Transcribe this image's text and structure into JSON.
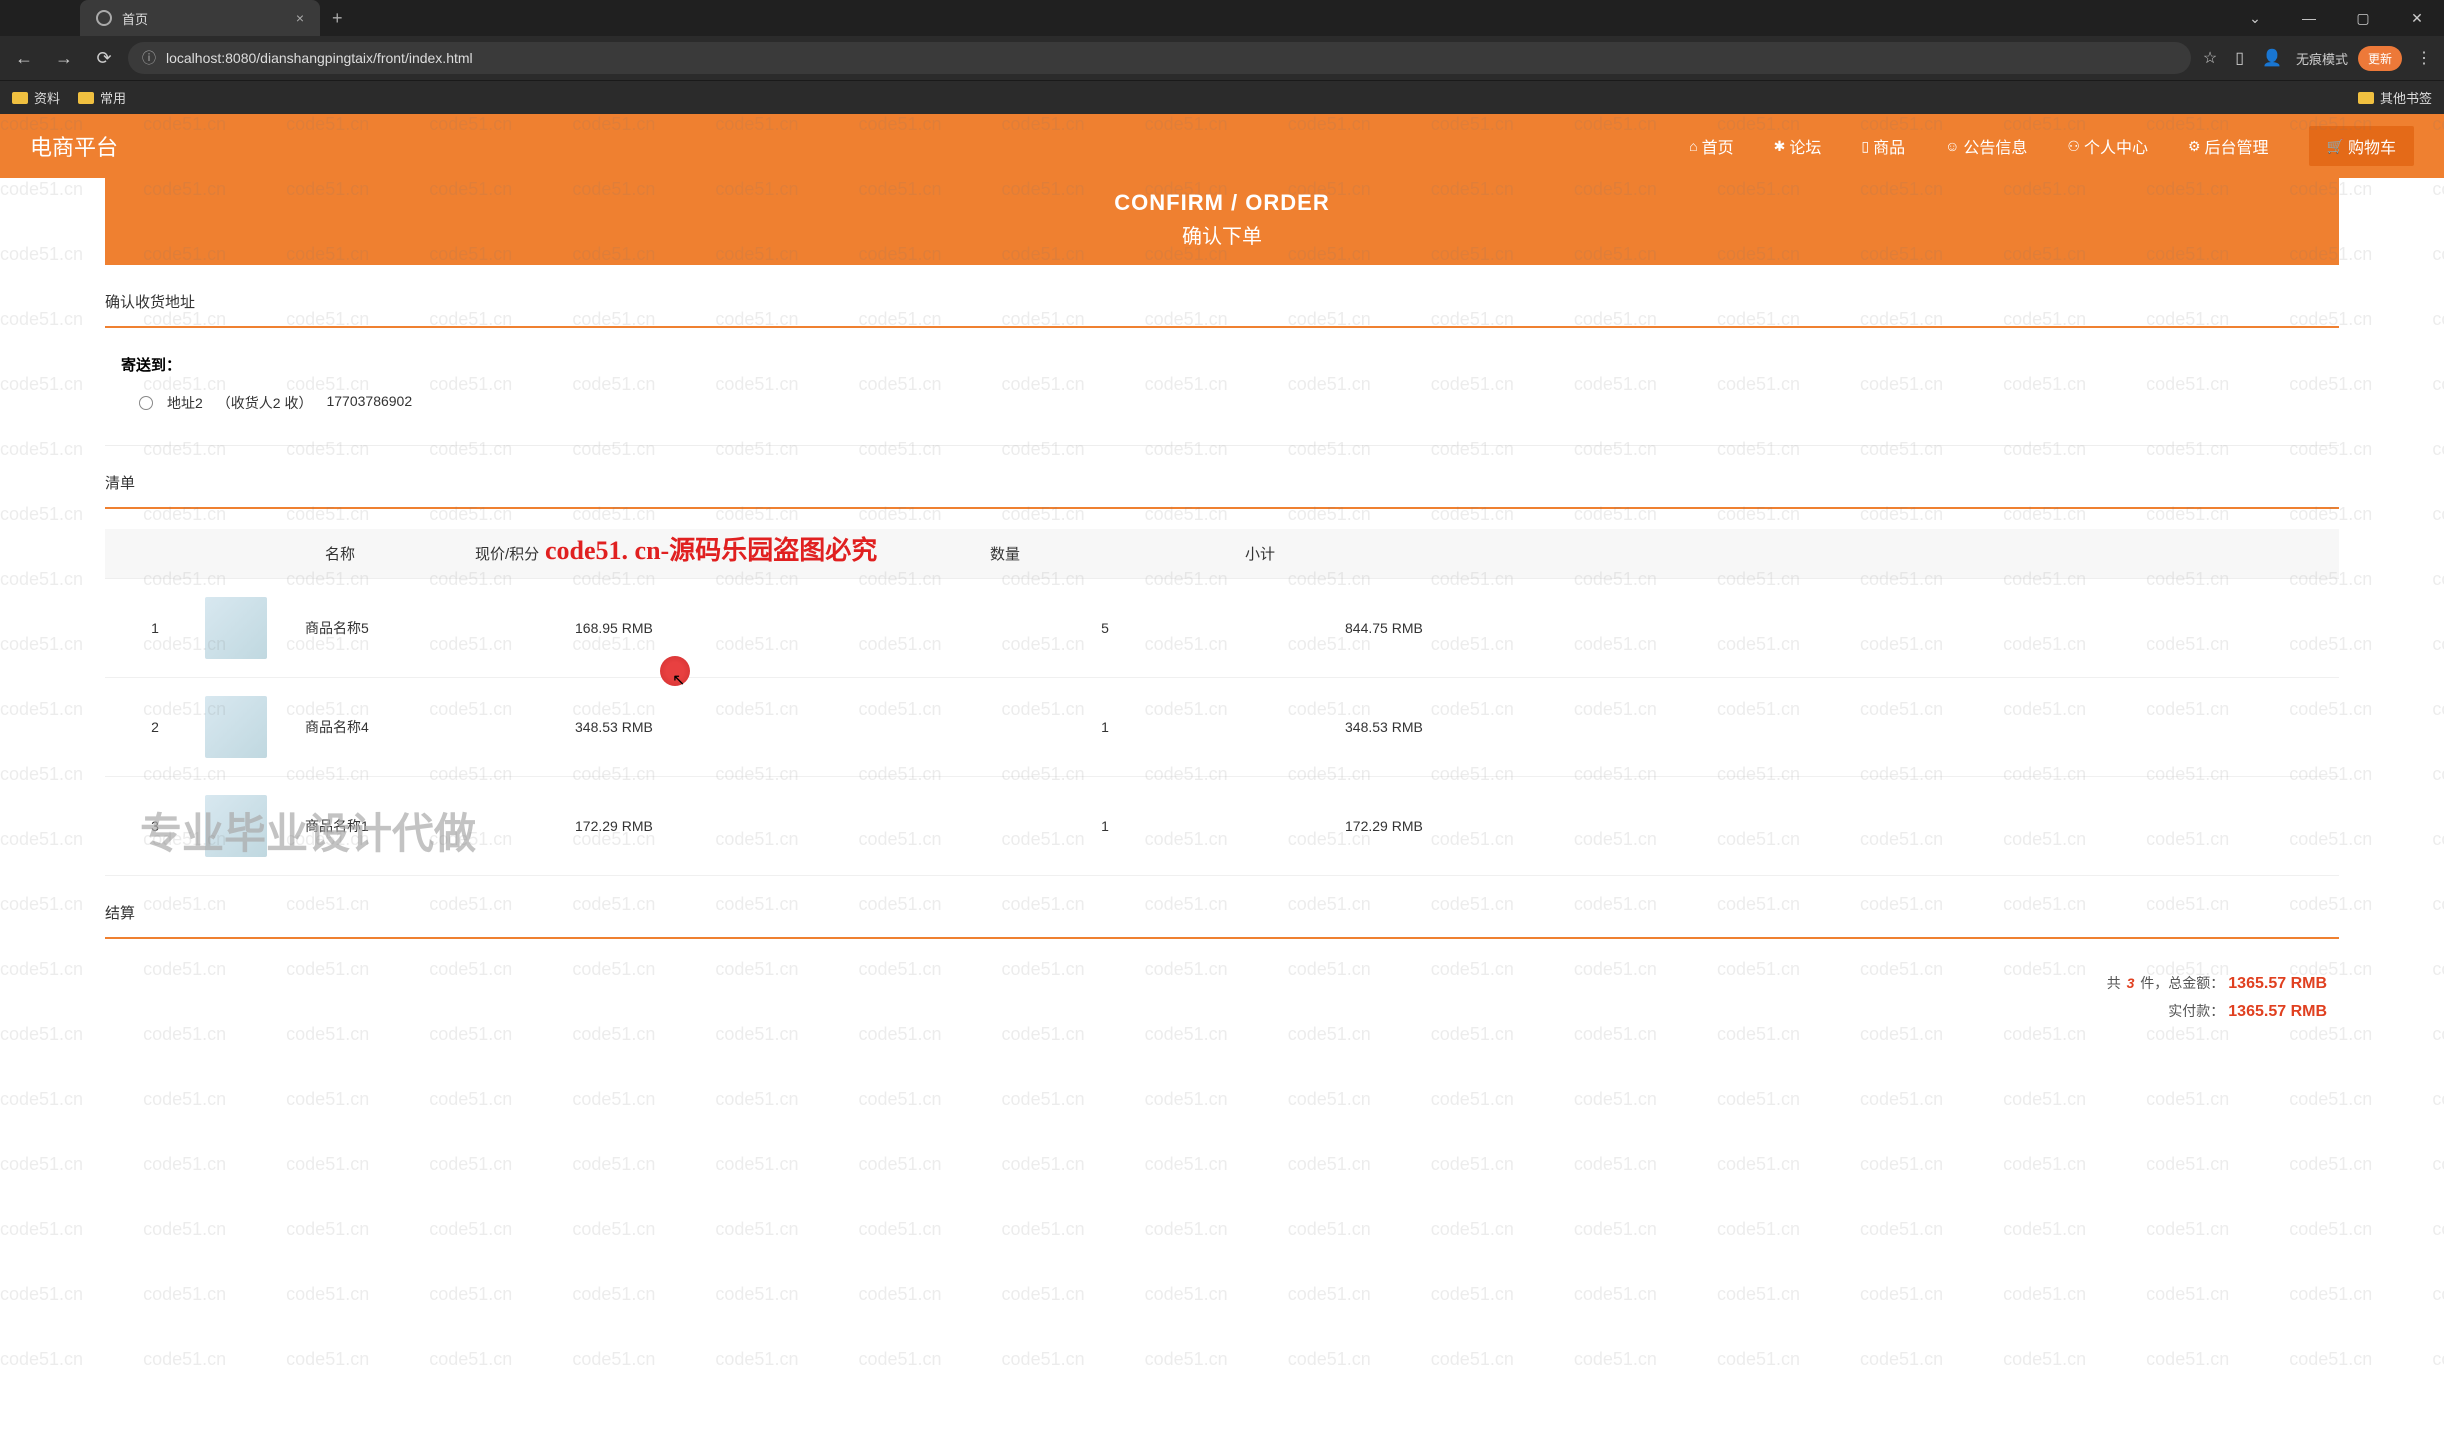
{
  "browser": {
    "tab_title": "首页",
    "url": "localhost:8080/dianshangpingtaix/front/index.html",
    "incognito": "无痕模式",
    "update": "更新",
    "bookmarks": [
      "资料",
      "常用"
    ],
    "other_bookmarks": "其他书签"
  },
  "header": {
    "logo": "电商平台",
    "nav": [
      {
        "icon": "⌂",
        "label": "首页"
      },
      {
        "icon": "✱",
        "label": "论坛"
      },
      {
        "icon": "▯",
        "label": "商品"
      },
      {
        "icon": "☺",
        "label": "公告信息"
      },
      {
        "icon": "⚇",
        "label": "个人中心"
      },
      {
        "icon": "⚙",
        "label": "后台管理"
      }
    ],
    "cart": {
      "icon": "🛒",
      "label": "购物车"
    }
  },
  "confirm": {
    "en": "CONFIRM / ORDER",
    "cn": "确认下单"
  },
  "address_section": {
    "title": "确认收货地址",
    "send_to": "寄送到：",
    "addr_name": "地址2",
    "addr_recipient": "（收货人2 收）",
    "addr_phone": "17703786902"
  },
  "list_section": {
    "title": "清单",
    "headers": {
      "name": "名称",
      "price": "现价/积分",
      "qty": "数量",
      "subtotal": "小计"
    },
    "rows": [
      {
        "idx": "1",
        "name": "商品名称5",
        "price": "168.95 RMB",
        "qty": "5",
        "subtotal": "844.75 RMB"
      },
      {
        "idx": "2",
        "name": "商品名称4",
        "price": "348.53 RMB",
        "qty": "1",
        "subtotal": "348.53 RMB"
      },
      {
        "idx": "3",
        "name": "商品名称1",
        "price": "172.29 RMB",
        "qty": "1",
        "subtotal": "172.29 RMB"
      }
    ]
  },
  "settle": {
    "title": "结算",
    "count_pre": "共 ",
    "count": "3",
    "count_post": " 件，总金额：",
    "total": "1365.57 RMB",
    "pay_label": "实付款：",
    "pay": "1365.57 RMB"
  },
  "watermarks": {
    "red": "code51. cn-源码乐园盗图必究",
    "grey": "专业毕业设计代做",
    "repeat": "code51.cn"
  }
}
